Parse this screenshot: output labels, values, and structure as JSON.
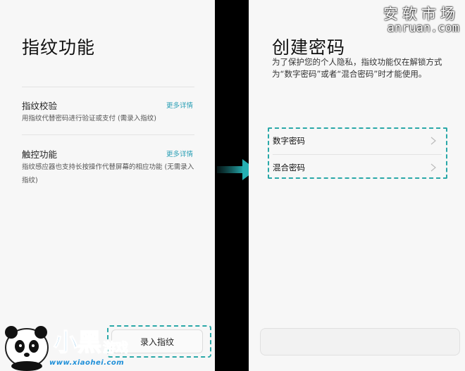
{
  "left_screen": {
    "title": "指纹功能",
    "items": [
      {
        "title": "指纹校验",
        "more": "更多详情",
        "desc": "用指纹代替密码进行验证或支付 (需录入指纹)"
      },
      {
        "title": "触控功能",
        "more": "更多详情",
        "desc": "指纹感应器也支持长按操作代替屏幕的相应功能 (无需录入指纹)"
      }
    ],
    "enroll_button": "录入指纹"
  },
  "right_screen": {
    "title": "创建密码",
    "desc": "为了保护您的个人隐私，指纹功能仅在解锁方式为“数字密码”或者“混合密码”时才能使用。",
    "options": [
      {
        "label": "数字密码"
      },
      {
        "label": "混合密码"
      }
    ]
  },
  "watermark": {
    "cn": "安软市场",
    "en": "anruan.com"
  },
  "logo": {
    "text": "小黑游戏",
    "url": "www.xiaohei.com"
  },
  "colors": {
    "accent": "#2aa8a8",
    "link": "#2a9fb5",
    "background": "#f7f7f7"
  }
}
